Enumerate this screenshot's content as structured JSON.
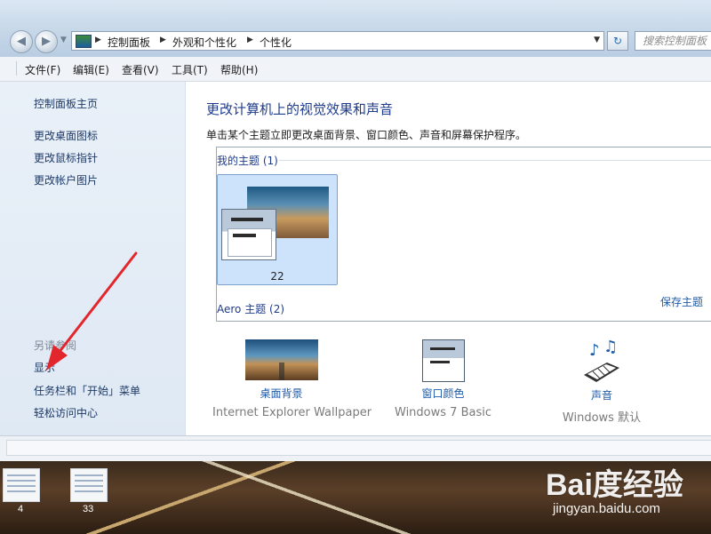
{
  "address_bar": {
    "crumbs": [
      "控制面板",
      "外观和个性化",
      "个性化"
    ],
    "search_placeholder": "搜索控制面板"
  },
  "menubar": {
    "items": [
      "文件(F)",
      "编辑(E)",
      "查看(V)",
      "工具(T)",
      "帮助(H)"
    ]
  },
  "sidebar": {
    "home": "控制面板主页",
    "links": [
      "更改桌面图标",
      "更改鼠标指针",
      "更改帐户图片"
    ],
    "see_also_heading": "另请参阅",
    "see_also": [
      "显示",
      "任务栏和「开始」菜单",
      "轻松访问中心"
    ]
  },
  "main": {
    "title": "更改计算机上的视觉效果和声音",
    "description": "单击某个主题立即更改桌面背景、窗口颜色、声音和屏幕保护程序。",
    "my_themes_title": "我的主题 (1)",
    "theme_name": "22",
    "save_theme": "保存主题",
    "aero_themes_title": "Aero 主题 (2)",
    "options": [
      {
        "label": "桌面背景",
        "sub": "Internet Explorer Wallpaper",
        "icon": "desktop-background-icon"
      },
      {
        "label": "窗口颜色",
        "sub": "Windows 7 Basic",
        "icon": "window-color-icon"
      },
      {
        "label": "声音",
        "sub": "Windows 默认",
        "icon": "sounds-icon"
      }
    ]
  },
  "taskbar_thumbs": [
    "4",
    "33"
  ],
  "watermark": {
    "logo": "Bai度经验",
    "url": "jingyan.baidu.com"
  },
  "colors": {
    "link": "#1e5aa8",
    "heading": "#1e3c8c",
    "annotation_arrow": "#e3262c"
  }
}
